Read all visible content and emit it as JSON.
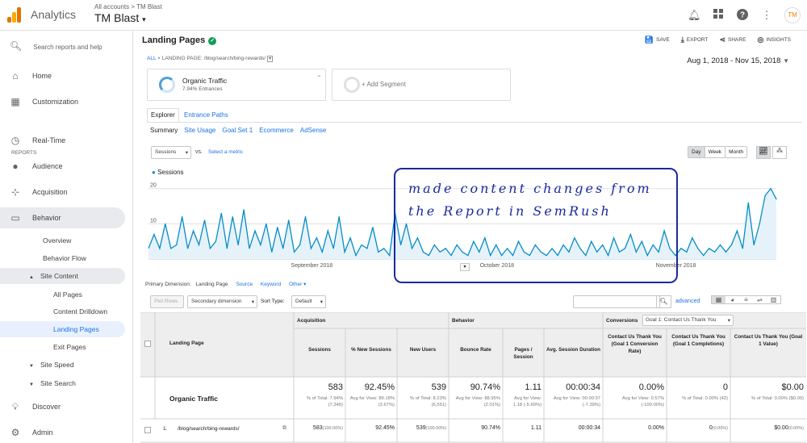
{
  "app": {
    "brand": "Analytics",
    "breadcrumb": "All accounts > TM Blast",
    "account": "TM Blast",
    "avatar": "TM"
  },
  "sidebar": {
    "search_placeholder": "Search reports and help",
    "section_reports": "REPORTS",
    "items": [
      {
        "label": "Home"
      },
      {
        "label": "Customization"
      },
      {
        "label": "Real-Time"
      },
      {
        "label": "Audience"
      },
      {
        "label": "Acquisition"
      },
      {
        "label": "Behavior"
      },
      {
        "label": "Discover"
      },
      {
        "label": "Admin"
      }
    ],
    "behavior_sub": [
      "Overview",
      "Behavior Flow",
      "Site Content",
      "All Pages",
      "Content Drilldown",
      "Landing Pages",
      "Exit Pages",
      "Site Speed",
      "Site Search"
    ]
  },
  "page": {
    "title": "Landing Pages",
    "actions": [
      "SAVE",
      "EXPORT",
      "SHARE",
      "INSIGHTS"
    ],
    "filter_all": "ALL",
    "filter_text": "LANDING PAGE: /blog/search/bing-rewards/",
    "date_range": "Aug 1, 2018 - Nov 15, 2018",
    "segment_name": "Organic Traffic",
    "segment_sub": "7.94% Entrances",
    "add_segment": "+ Add Segment",
    "tabs": [
      "Explorer",
      "Entrance Paths"
    ],
    "subtabs": [
      "Summary",
      "Site Usage",
      "Goal Set 1",
      "Ecommerce",
      "AdSense"
    ],
    "metric": "Sessions",
    "vs": "vs.",
    "select_metric": "Select a metric",
    "granularity": [
      "Day",
      "Week",
      "Month"
    ],
    "primary_dimension_label": "Primary Dimension:",
    "primary_dimension": "Landing Page",
    "dims": [
      "Source",
      "Keyword",
      "Other"
    ],
    "plot_rows": "Plot Rows",
    "secondary_dimension": "Secondary dimension",
    "sort_type_label": "Sort Type:",
    "sort_type": "Default",
    "advanced": "advanced"
  },
  "chart_data": {
    "type": "line",
    "title": "",
    "series": [
      {
        "name": "Sessions",
        "values": [
          3,
          7,
          3,
          10,
          3,
          4,
          12,
          3,
          8,
          4,
          11,
          3,
          5,
          13,
          3,
          12,
          4,
          14,
          3,
          8,
          4,
          10,
          2,
          9,
          3,
          11,
          2,
          4,
          12,
          3,
          6,
          2,
          8,
          3,
          12,
          2,
          6,
          1,
          4,
          3,
          9,
          2,
          3,
          1,
          13,
          4,
          10,
          3,
          6,
          2,
          1,
          4,
          2,
          3,
          1,
          4,
          2,
          1,
          5,
          2,
          6,
          1,
          4,
          1,
          3,
          1,
          5,
          2,
          1,
          4,
          2,
          1,
          3,
          1,
          4,
          2,
          6,
          3,
          1,
          5,
          2,
          4,
          1,
          6,
          2,
          3,
          7,
          2,
          5,
          1,
          4,
          2,
          8,
          3,
          1,
          3,
          2,
          6,
          3,
          1,
          3,
          2,
          4,
          2,
          4,
          8,
          3,
          16,
          4,
          10,
          18,
          20,
          17
        ]
      }
    ],
    "x_tick_labels": [
      "September 2018",
      "October 2018",
      "November 2018"
    ],
    "y_tick_labels": [
      "10",
      "20"
    ],
    "ylim": [
      0,
      22
    ],
    "color": "#058dc7"
  },
  "annotation": {
    "line1": "made content changes from",
    "line2": "the Report in SemRush"
  },
  "table": {
    "headers": {
      "landing_page": "Landing Page",
      "acquisition": "Acquisition",
      "behavior": "Behavior",
      "conversions": "Conversions",
      "goal_select": "Goal 1: Contact Us Thank You"
    },
    "columns": [
      "Sessions",
      "% New Sessions",
      "New Users",
      "Bounce Rate",
      "Pages / Session",
      "Avg. Session Duration",
      "Contact Us Thank You (Goal 1 Conversion Rate)",
      "Contact Us Thank You (Goal 1 Completions)",
      "Contact Us Thank You (Goal 1 Value)"
    ],
    "total_label": "Organic Traffic",
    "totals": [
      "583",
      "92.45%",
      "539",
      "90.74%",
      "1.11",
      "00:00:34",
      "0.00%",
      "0",
      "$0.00"
    ],
    "total_subs": [
      "% of Total: 7.94% (7,346)",
      "Avg for View: 89.18% (3.67%)",
      "% of Total: 8.23% (6,551)",
      "Avg for View: 88.95% (2.01%)",
      "Avg for View: 1.18 (-5.69%)",
      "Avg for View: 00:00:37 (-7.39%)",
      "Avg for View: 0.57% (-100.00%)",
      "% of Total: 0.00% (42)",
      "% of Total: 0.00% ($0.00)"
    ],
    "row": {
      "num": "1.",
      "page": "/blog/search/bing-rewards/",
      "values": [
        "583",
        "92.45%",
        "539",
        "90.74%",
        "1.11",
        "00:00:34",
        "0.00%",
        "0",
        "$0.00"
      ],
      "pcts": [
        "(100.00%)",
        "",
        "(100.00%)",
        "",
        "",
        "",
        "",
        "(0.00%)",
        "(0.00%)"
      ]
    }
  }
}
